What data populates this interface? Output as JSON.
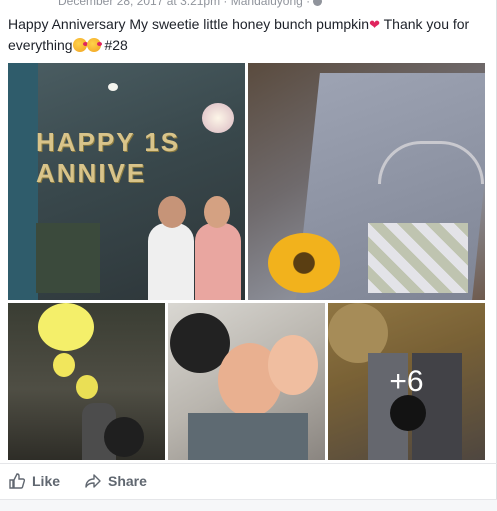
{
  "post": {
    "meta_line": "December 28, 2017 at 3:21pm · Mandaluyong ·",
    "text_main": "Happy Anniversary My sweetie little honey bunch pumpkin",
    "text_after_heart": " Thank you for everything",
    "text_tag": " #28"
  },
  "gallery": {
    "photo1_letters": "HAPPY 1S ANNIVE",
    "more_count": "+6"
  },
  "actions": {
    "like_label": "Like",
    "share_label": "Share"
  },
  "colors": {
    "text": "#1d2129",
    "muted": "#606770",
    "accent": "#e0245e"
  }
}
